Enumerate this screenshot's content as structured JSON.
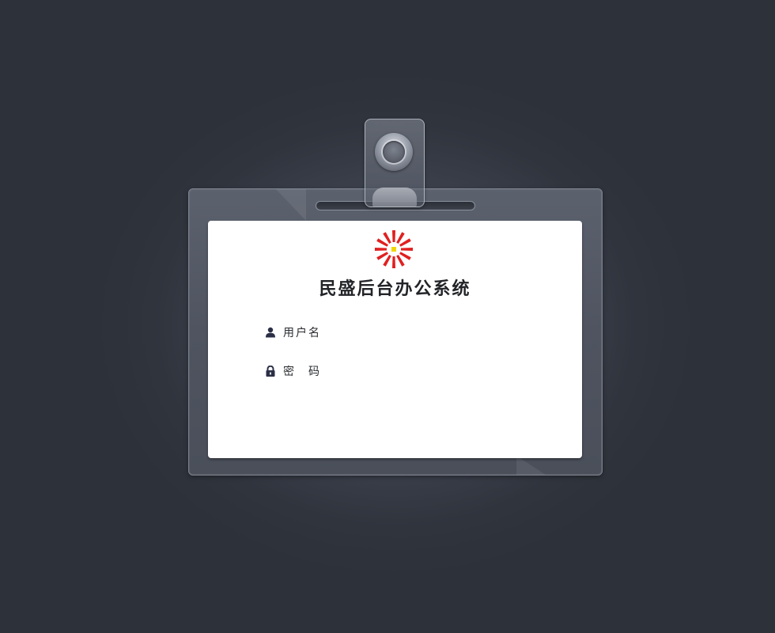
{
  "app": {
    "title": "民盛后台办公系统"
  },
  "form": {
    "username_label": "用户名",
    "username_value": "",
    "password_label": "密　码",
    "password_value": ""
  },
  "icons": {
    "logo": "sunburst-logo",
    "username": "user-icon",
    "password": "lock-icon"
  },
  "colors": {
    "logo_red": "#e02020",
    "logo_center": "#f2d600",
    "icon": "#2b2f45"
  }
}
